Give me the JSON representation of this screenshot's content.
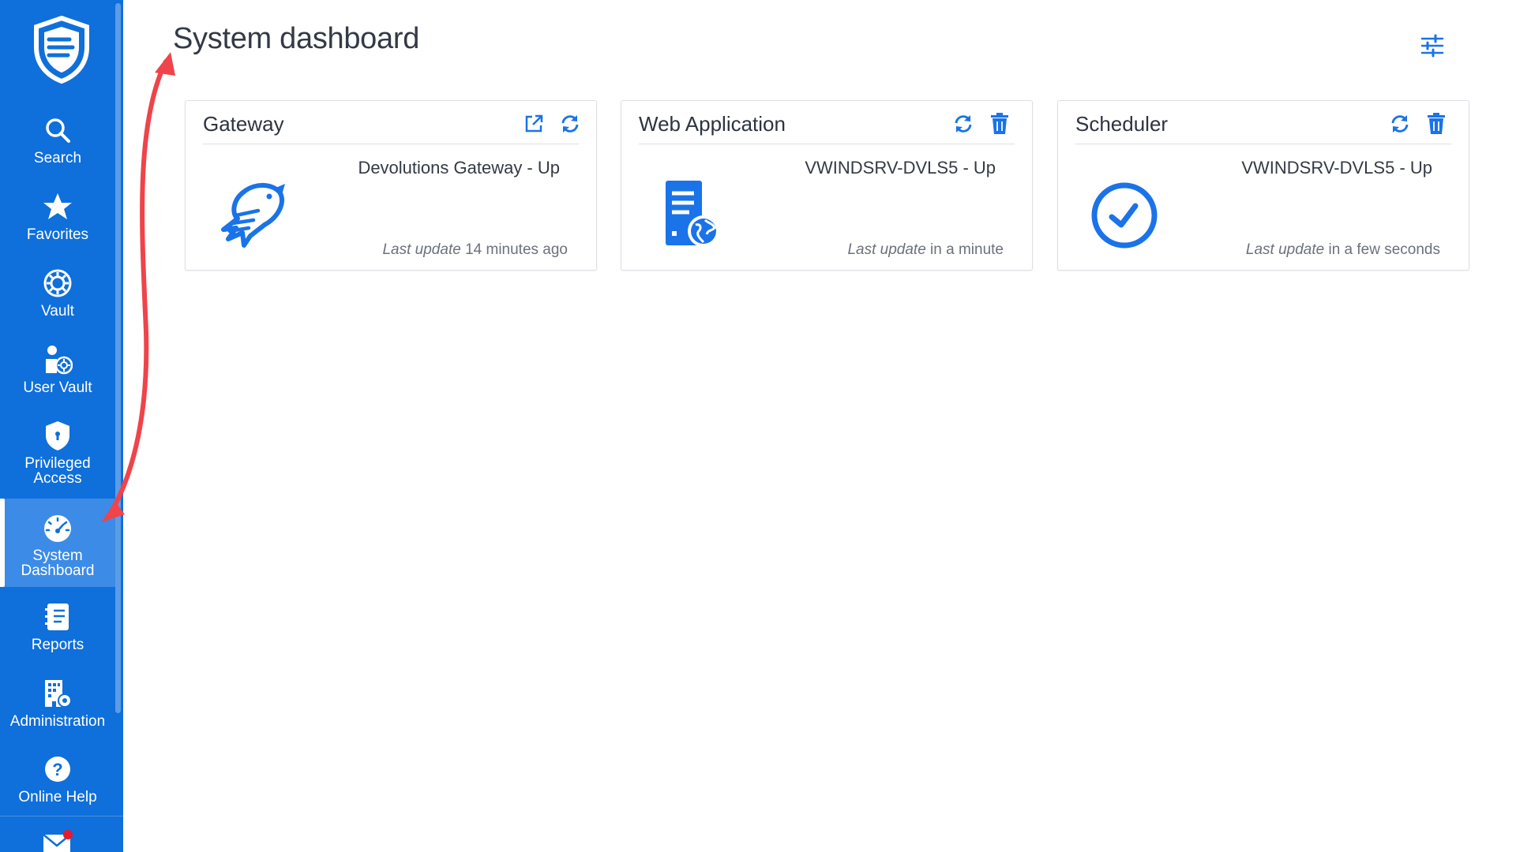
{
  "page": {
    "title": "System dashboard"
  },
  "sidebar": {
    "items": [
      {
        "label": "Search",
        "icon": "search-icon"
      },
      {
        "label": "Favorites",
        "icon": "star-icon"
      },
      {
        "label": "Vault",
        "icon": "vault-icon"
      },
      {
        "label": "User Vault",
        "icon": "user-vault-icon"
      },
      {
        "label": "Privileged Access",
        "icon": "shield-lock-icon"
      },
      {
        "label": "System Dashboard",
        "icon": "gauge-icon",
        "active": true
      },
      {
        "label": "Reports",
        "icon": "report-icon"
      },
      {
        "label": "Administration",
        "icon": "building-gear-icon"
      },
      {
        "label": "Online Help",
        "icon": "help-icon"
      },
      {
        "label": "",
        "icon": "mail-icon",
        "notification": true
      }
    ]
  },
  "cards": [
    {
      "title": "Gateway",
      "status": "Devolutions Gateway - Up",
      "update_label": "Last update",
      "update_value": "14 minutes ago",
      "actions": [
        "open-external-icon",
        "refresh-icon"
      ],
      "icon": "gateway-bird-icon"
    },
    {
      "title": "Web Application",
      "status": "VWINDSRV-DVLS5 - Up",
      "update_label": "Last update",
      "update_value": "in a minute",
      "actions": [
        "refresh-icon",
        "trash-icon"
      ],
      "icon": "web-server-icon"
    },
    {
      "title": "Scheduler",
      "status": "VWINDSRV-DVLS5 - Up",
      "update_label": "Last update",
      "update_value": "in a few seconds",
      "actions": [
        "refresh-icon",
        "trash-icon"
      ],
      "icon": "clock-check-icon"
    }
  ],
  "colors": {
    "sidebar": "#0f6fdb",
    "accent": "#1a73e8",
    "annotation": "#f0434a"
  }
}
